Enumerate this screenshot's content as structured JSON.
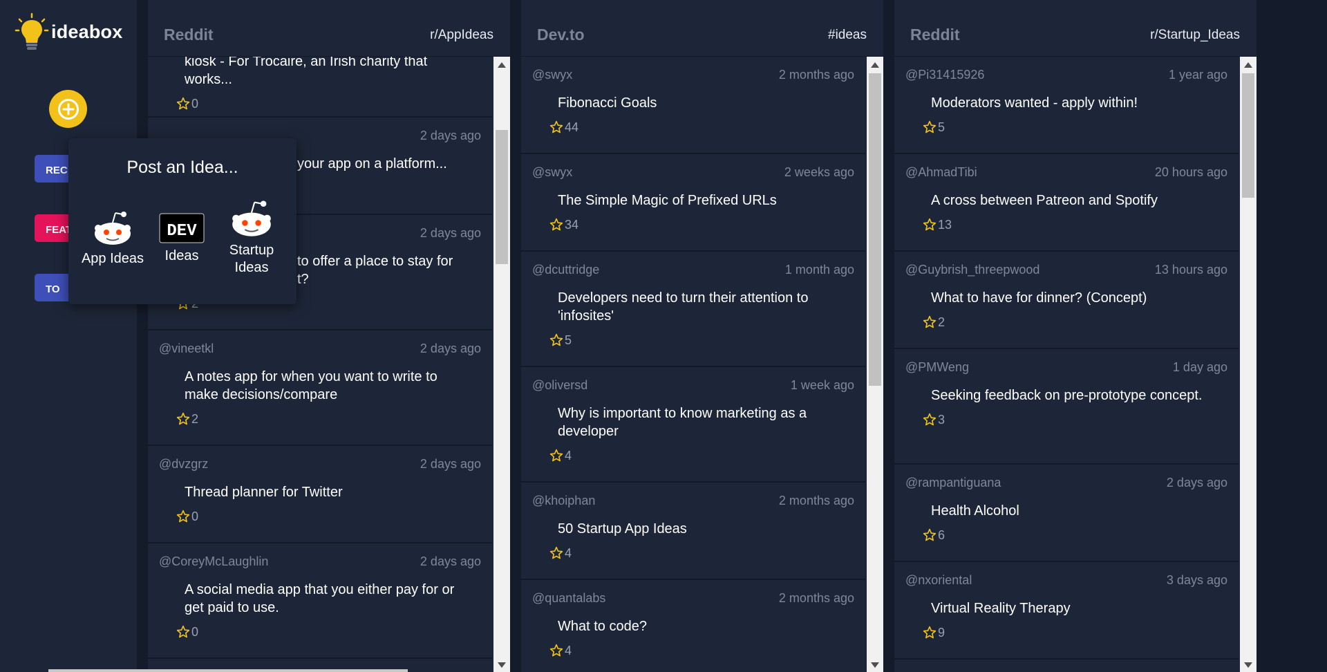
{
  "app": {
    "name": "ideabox"
  },
  "colors": {
    "accent_yellow": "#f2c21b",
    "tab_blue": "#3f4fba",
    "tab_pink": "#e5135a",
    "panel": "#1d2638",
    "background": "#141b2b"
  },
  "sidebar": {
    "add_button_icon": "plus-circle-icon",
    "tabs": [
      {
        "label": "RECENT",
        "visible_label": "REC"
      },
      {
        "label": "FEATURED",
        "visible_label": "FEATU"
      },
      {
        "label": "TOP",
        "visible_label": "TO"
      }
    ]
  },
  "popup": {
    "title": "Post an Idea...",
    "options": [
      {
        "label": "App Ideas",
        "icon": "reddit-icon"
      },
      {
        "label": "Ideas",
        "icon": "dev-icon"
      },
      {
        "label": "Startup Ideas",
        "icon": "reddit-icon"
      }
    ]
  },
  "columns": [
    {
      "source": "Reddit",
      "tag": "r/AppIdeas",
      "scroll_position": 0.12,
      "cards": [
        {
          "user": "",
          "time": "",
          "title": "kiosk - For Trocaire, an Irish charity that works...",
          "stars": "0",
          "partial": true
        },
        {
          "user": "",
          "time": "2 days ago",
          "title": "your app on a platform...",
          "stars": "",
          "obscured": true
        },
        {
          "user": "",
          "time": "2 days ago",
          "title": "to offer a place to stay for\nt?",
          "stars": "2",
          "obscured": true
        },
        {
          "user": "@vineetkl",
          "time": "2 days ago",
          "title": "A notes app for when you want to write to make decisions/compare",
          "stars": "2"
        },
        {
          "user": "@dvzgrz",
          "time": "2 days ago",
          "title": "Thread planner for Twitter",
          "stars": "0"
        },
        {
          "user": "@CoreyMcLaughlin",
          "time": "2 days ago",
          "title": "A social media app that you either pay for or get paid to use.",
          "stars": "0"
        }
      ]
    },
    {
      "source": "Dev.to",
      "tag": "#ideas",
      "scroll_position": 0.0,
      "cards": [
        {
          "user": "@swyx",
          "time": "2 months ago",
          "title": "Fibonacci Goals",
          "stars": "44"
        },
        {
          "user": "@swyx",
          "time": "2 weeks ago",
          "title": "The Simple Magic of Prefixed URLs",
          "stars": "34"
        },
        {
          "user": "@dcuttridge",
          "time": "1 month ago",
          "title": "Developers need to turn their attention to 'infosites'",
          "stars": "5"
        },
        {
          "user": "@oliversd",
          "time": "1 week ago",
          "title": "Why is important to know marketing as a developer",
          "stars": "4"
        },
        {
          "user": "@khoiphan",
          "time": "2 months ago",
          "title": "50 Startup App Ideas",
          "stars": "4"
        },
        {
          "user": "@quantalabs",
          "time": "2 months ago",
          "title": "What to code?",
          "stars": "4"
        }
      ]
    },
    {
      "source": "Reddit",
      "tag": "r/Startup_Ideas",
      "scroll_position": 0.0,
      "cards": [
        {
          "user": "@Pi31415926",
          "time": "1 year ago",
          "title": "Moderators wanted - apply within!",
          "stars": "5"
        },
        {
          "user": "@AhmadTibi",
          "time": "20 hours ago",
          "title": "A cross between Patreon and Spotify",
          "stars": "13"
        },
        {
          "user": "@Guybrish_threepwood",
          "time": "13 hours ago",
          "title": "What to have for dinner? (Concept)",
          "stars": "2"
        },
        {
          "user": "@PMWeng",
          "time": "1 day ago",
          "title": "Seeking feedback on pre-prototype concept.",
          "stars": "3"
        },
        {
          "user": "@rampantiguana",
          "time": "2 days ago",
          "title": "Health Alcohol",
          "stars": "6"
        },
        {
          "user": "@nxoriental",
          "time": "3 days ago",
          "title": "Virtual Reality Therapy",
          "stars": "9"
        }
      ]
    }
  ]
}
